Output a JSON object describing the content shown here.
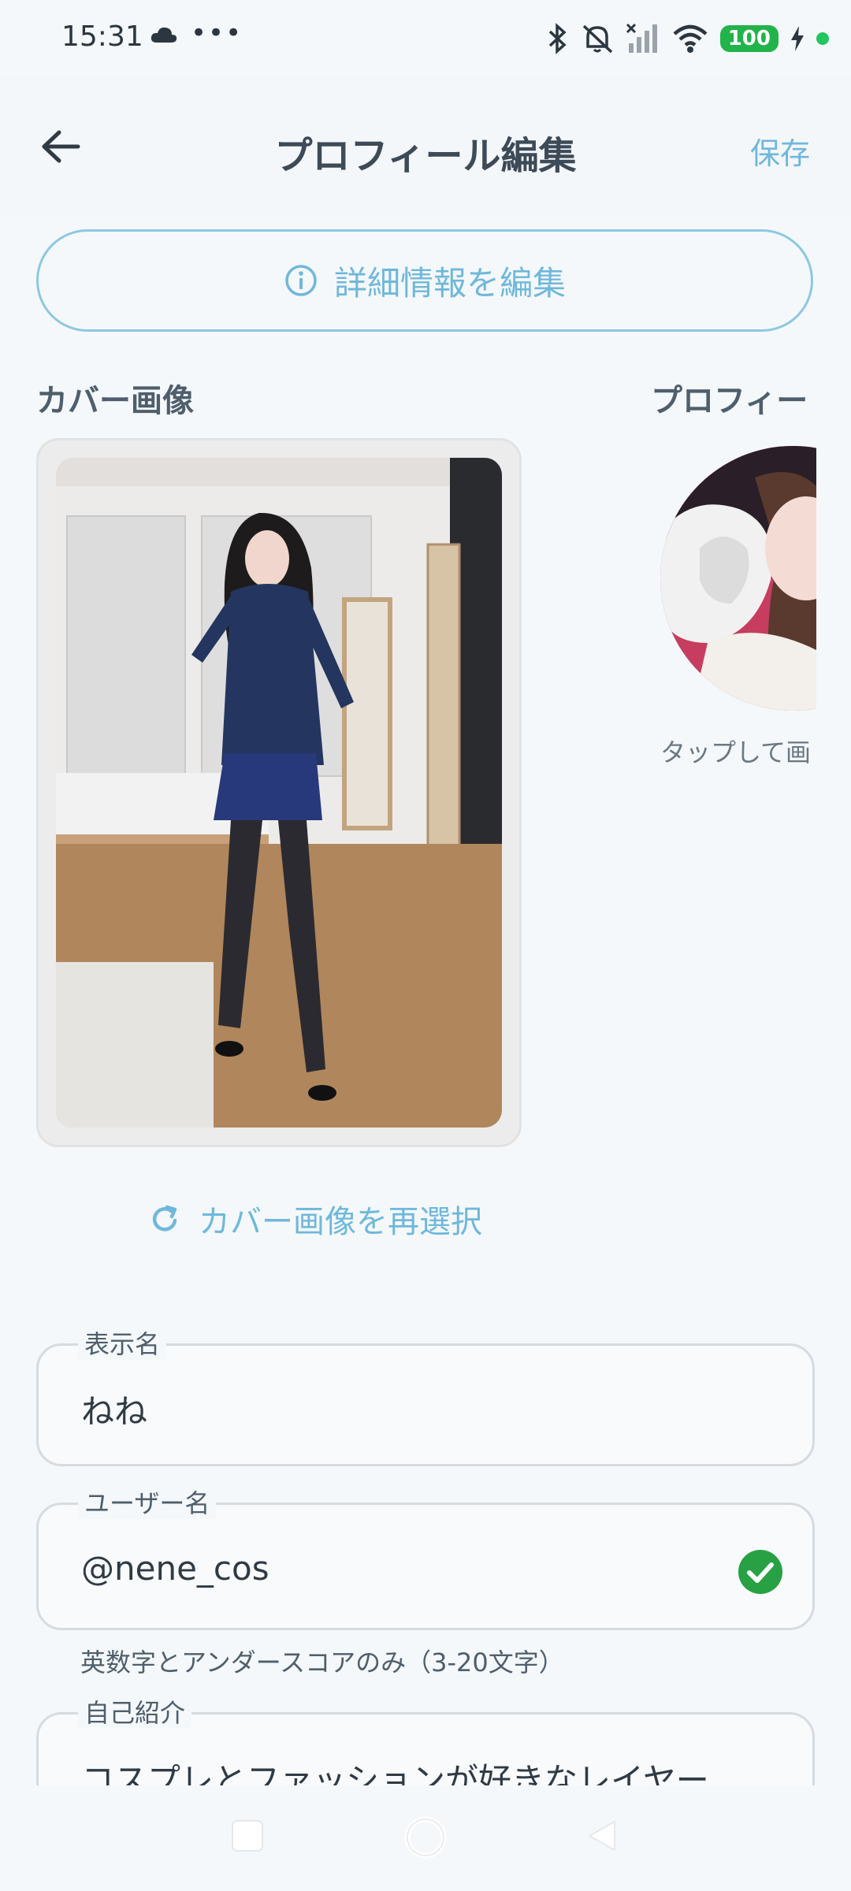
{
  "status": {
    "time": "15:31",
    "dots": "•••",
    "battery": "100"
  },
  "header": {
    "title": "プロフィール編集",
    "save_label": "保存"
  },
  "edit_details_label": "詳細情報を編集",
  "cover": {
    "label": "カバー画像",
    "reselect_label": "カバー画像を再選択"
  },
  "profile": {
    "label": "プロフィー",
    "tap_hint": "タップして画"
  },
  "fields": {
    "display_name": {
      "label": "表示名",
      "value": "ねね"
    },
    "username": {
      "label": "ユーザー名",
      "value": "@nene_cos",
      "helper": "英数字とアンダースコアのみ（3-20文字）",
      "status": "valid"
    },
    "bio": {
      "label": "自己紹介",
      "value": "コスプレとファッションが好きなレイヤー"
    }
  },
  "colors": {
    "accent": "#6fb8db",
    "success": "#27a143",
    "background": "#f5f8fa"
  }
}
